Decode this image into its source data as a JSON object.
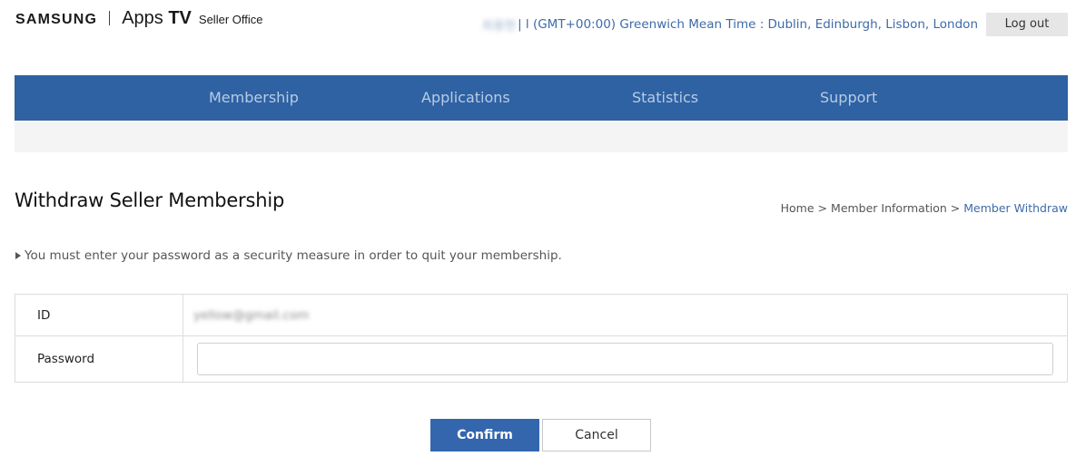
{
  "header": {
    "logo": {
      "brand": "SAMSUNG",
      "product_apps": "Apps",
      "product_tv": "TV",
      "product_suffix": "Seller Office"
    },
    "user_name": "최용현",
    "timezone_text": "| l (GMT+00:00) Greenwich Mean Time : Dublin, Edinburgh, Lisbon, London",
    "logout_label": "Log out"
  },
  "nav": {
    "items": [
      {
        "label": "Membership"
      },
      {
        "label": "Applications"
      },
      {
        "label": "Statistics"
      },
      {
        "label": "Support"
      }
    ]
  },
  "page": {
    "title": "Withdraw Seller Membership",
    "breadcrumb": {
      "items": [
        "Home",
        "Member Information",
        "Member Withdraw"
      ],
      "separator": ">"
    },
    "notice": "You must enter your password as a security measure in order to quit your membership."
  },
  "form": {
    "id_label": "ID",
    "id_value_local": "yellow",
    "id_value_domain": "@gmail.com",
    "password_label": "Password",
    "password_value": "",
    "password_placeholder": ""
  },
  "actions": {
    "confirm_label": "Confirm",
    "cancel_label": "Cancel"
  },
  "colors": {
    "nav_background": "#2e62a3",
    "link_blue": "#3e6ba8",
    "confirm_button": "#3466ad"
  }
}
